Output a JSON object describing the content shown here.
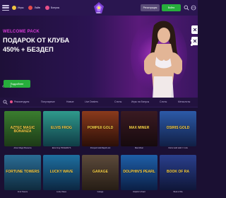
{
  "header": {
    "nav": [
      {
        "label": "Игры",
        "icon": "dice-icon",
        "color": "#f0c341"
      },
      {
        "label": "Лайв",
        "icon": "live-icon",
        "color": "#e34b4b"
      },
      {
        "label": "Бонусы",
        "icon": "gift-icon",
        "color": "#e9508a"
      }
    ],
    "logo_text": "SOL",
    "register_label": "Регистрация",
    "login_label": "Войти"
  },
  "banner": {
    "kicker": "WELCOME PACK",
    "title_line1": "ПОДАРОК ОТ КЛУБА",
    "title_line2": "450% + БЕЗДЕП",
    "cta": "Подробнее"
  },
  "categories": [
    "Рекомендуем",
    "Популярные",
    "Новые",
    "Live Dealers",
    "",
    "Слоты",
    "Игры на бонусы",
    "Слоты",
    "Мегаслоты"
  ],
  "games": [
    {
      "title": "AZTEC MAGIC BONANZA",
      "label": "Aztec Magic Bonanza",
      "bg1": "#3a7d2f",
      "bg2": "#1d3a17"
    },
    {
      "title": "ELVIS FROG",
      "label": "Elvis Frog TRUEWAYS",
      "bg1": "#2f9a8c",
      "bg2": "#0f3b45"
    },
    {
      "title": "POMPEII GOLD",
      "label": "Pompeii Gold Rapid Link",
      "bg1": "#8a3a1c",
      "bg2": "#2b0f08"
    },
    {
      "title": "MAX MINER",
      "label": "Max Miner",
      "bg1": "#3a1a22",
      "bg2": "#160a0e"
    },
    {
      "title": "OSIRIS GOLD",
      "label": "Osiris Gold Hold 'n' Link",
      "bg1": "#2c5aa8",
      "bg2": "#111f45"
    },
    {
      "title": "FORTUNE TOWERS",
      "label": "Fruit Towers",
      "bg1": "#2a6c94",
      "bg2": "#0f2b3e"
    },
    {
      "title": "LUCKY WAVE",
      "label": "Lucky Wave",
      "bg1": "#1e6fa0",
      "bg2": "#0c2742"
    },
    {
      "title": "GARAGE",
      "label": "Garage",
      "bg1": "#5c4a3b",
      "bg2": "#261d15"
    },
    {
      "title": "DOLPHIN'S PEARL",
      "label": "Dolphin's Pearl",
      "bg1": "#1e5fa8",
      "bg2": "#0b1f45"
    },
    {
      "title": "BOOK OF RA",
      "label": "Book of Ra",
      "bg1": "#2a3f8c",
      "bg2": "#0f1638"
    }
  ]
}
